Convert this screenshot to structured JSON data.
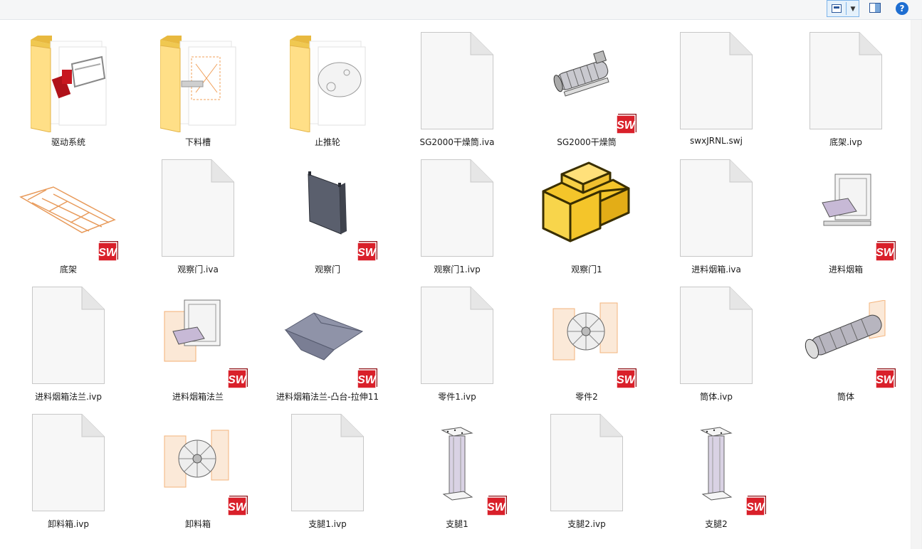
{
  "toolbar": {
    "view_button_icon": "change-view-icon",
    "view_dropdown_icon": "chevron-down-icon",
    "preview_pane_icon": "preview-pane-icon",
    "help_label": "?"
  },
  "items": [
    {
      "label": "驱动系统",
      "type": "folder",
      "thumb": "drive-assembly"
    },
    {
      "label": "下料槽",
      "type": "folder",
      "thumb": "orange-assembly"
    },
    {
      "label": "止推轮",
      "type": "folder",
      "thumb": "wheel"
    },
    {
      "label": "SG2000干燥筒.iva",
      "type": "doc"
    },
    {
      "label": "SG2000干燥筒",
      "type": "sw",
      "thumb": "dryer"
    },
    {
      "label": "swxJRNL.swj",
      "type": "doc"
    },
    {
      "label": "底架.ivp",
      "type": "doc"
    },
    {
      "label": "底架",
      "type": "sw",
      "thumb": "frame"
    },
    {
      "label": "观察门.iva",
      "type": "doc"
    },
    {
      "label": "观察门",
      "type": "sw",
      "thumb": "door"
    },
    {
      "label": "观察门1.ivp",
      "type": "doc"
    },
    {
      "label": "观察门1",
      "type": "part3d"
    },
    {
      "label": "进料烟箱.iva",
      "type": "doc"
    },
    {
      "label": "进料烟箱",
      "type": "sw",
      "thumb": "box"
    },
    {
      "label": "进料烟箱法兰.ivp",
      "type": "doc"
    },
    {
      "label": "进料烟箱法兰",
      "type": "sw",
      "thumb": "box-orange"
    },
    {
      "label": "进料烟箱法兰-凸台-拉伸11",
      "type": "sw",
      "thumb": "sheet"
    },
    {
      "label": "零件1.ivp",
      "type": "doc"
    },
    {
      "label": "零件2",
      "type": "sw",
      "thumb": "fan"
    },
    {
      "label": "筒体.ivp",
      "type": "doc"
    },
    {
      "label": "筒体",
      "type": "sw",
      "thumb": "cylinder"
    },
    {
      "label": "卸料箱.ivp",
      "type": "doc"
    },
    {
      "label": "卸料箱",
      "type": "sw",
      "thumb": "fan"
    },
    {
      "label": "支腿1.ivp",
      "type": "doc"
    },
    {
      "label": "支腿1",
      "type": "sw",
      "thumb": "leg"
    },
    {
      "label": "支腿2.ivp",
      "type": "doc"
    },
    {
      "label": "支腿2",
      "type": "sw",
      "thumb": "leg"
    }
  ],
  "colors": {
    "folder_back": "#f0c850",
    "folder_front": "#ffe08a",
    "sw_red": "#d9202a",
    "part_yellow": "#f4c52a",
    "accent": "#1e6ed1"
  }
}
